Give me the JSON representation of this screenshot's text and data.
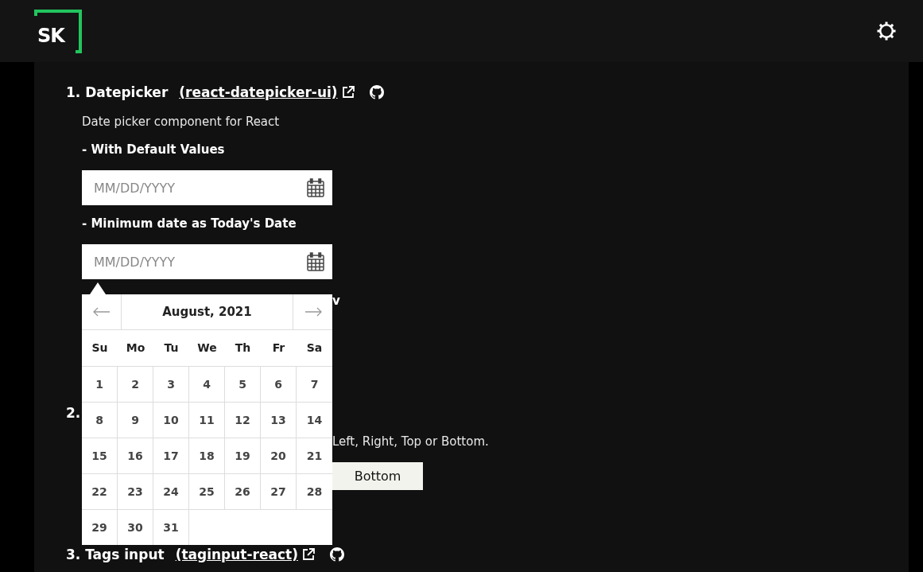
{
  "header": {
    "logo": "SK"
  },
  "sections": [
    {
      "number": "1.",
      "title": "Datepicker",
      "link": "(react-datepicker-ui)",
      "description": "Date picker component for React",
      "examples": [
        {
          "label": "- With Default Values",
          "placeholder": "MM/DD/YYYY"
        },
        {
          "label": "- Minimum date as Today's Date",
          "placeholder": "MM/DD/YYYY"
        }
      ],
      "partial_text": "v"
    },
    {
      "number": "2.",
      "description_fragment": "Left, Right, Top or Bottom.",
      "button": "Bottom"
    },
    {
      "number": "3.",
      "title": "Tags input",
      "link": "(taginput-react)"
    }
  ],
  "datepicker_popup": {
    "month": "August, 2021",
    "weekdays": [
      "Su",
      "Mo",
      "Tu",
      "We",
      "Th",
      "Fr",
      "Sa"
    ],
    "days": [
      "1",
      "2",
      "3",
      "4",
      "5",
      "6",
      "7",
      "8",
      "9",
      "10",
      "11",
      "12",
      "13",
      "14",
      "15",
      "16",
      "17",
      "18",
      "19",
      "20",
      "21",
      "22",
      "23",
      "24",
      "25",
      "26",
      "27",
      "28",
      "29",
      "30",
      "31"
    ]
  }
}
